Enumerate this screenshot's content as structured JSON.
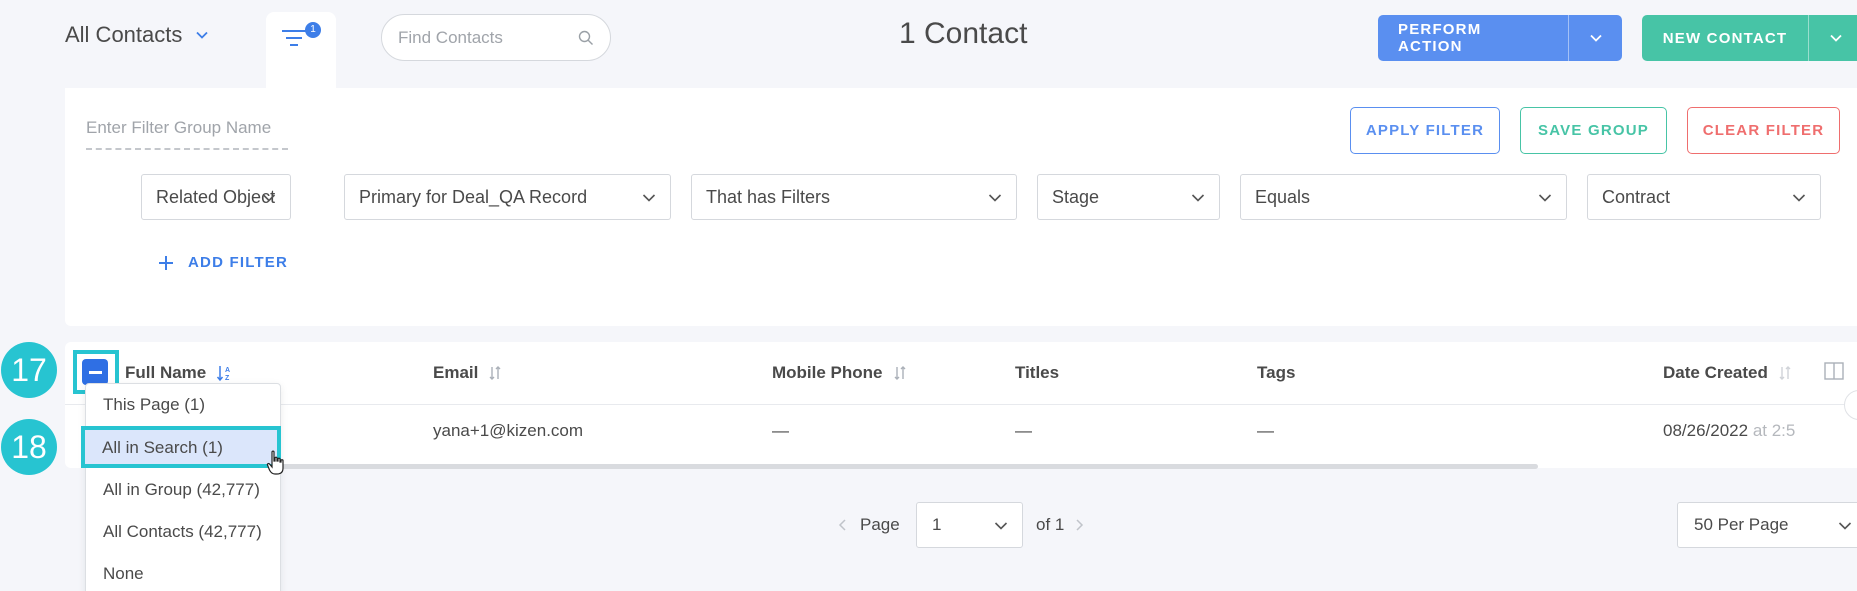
{
  "header": {
    "view_title": "All Contacts",
    "filter_badge_count": "1",
    "search_placeholder": "Find Contacts",
    "record_count": "1 Contact",
    "perform_action_label": "PERFORM ACTION",
    "new_contact_label": "NEW CONTACT"
  },
  "filter_panel": {
    "group_name_placeholder": "Enter Filter Group Name",
    "apply_label": "APPLY FILTER",
    "save_group_label": "SAVE GROUP",
    "clear_label": "CLEAR FILTER",
    "dropdowns": [
      "Related Object",
      "Primary for Deal_QA Record",
      "That has Filters",
      "Stage",
      "Equals",
      "Contract"
    ],
    "add_filter_label": "ADD FILTER"
  },
  "table": {
    "columns": [
      "Full Name",
      "Email",
      "Mobile Phone",
      "Titles",
      "Tags",
      "Date Created"
    ],
    "rows": [
      {
        "email": "yana+1@kizen.com",
        "mobile_phone": "—",
        "titles": "—",
        "tags": "—",
        "date_created": "08/26/2022",
        "date_created_suffix": "at 2:5"
      }
    ]
  },
  "select_menu": {
    "options": [
      "This Page (1)",
      "All in Search (1)",
      "All in Group (42,777)",
      "All Contacts (42,777)",
      "None"
    ],
    "highlighted": "All in Search (1)"
  },
  "annotations": {
    "step_a": "17",
    "step_b": "18",
    "highlight_color": "#27c4d1"
  },
  "pagination": {
    "page_label": "Page",
    "current_page": "1",
    "of_label": "of 1",
    "per_page": "50 Per Page"
  },
  "colors": {
    "primary": "#5a8ff0",
    "success": "#47c4a6",
    "danger": "#ef6e6e"
  }
}
